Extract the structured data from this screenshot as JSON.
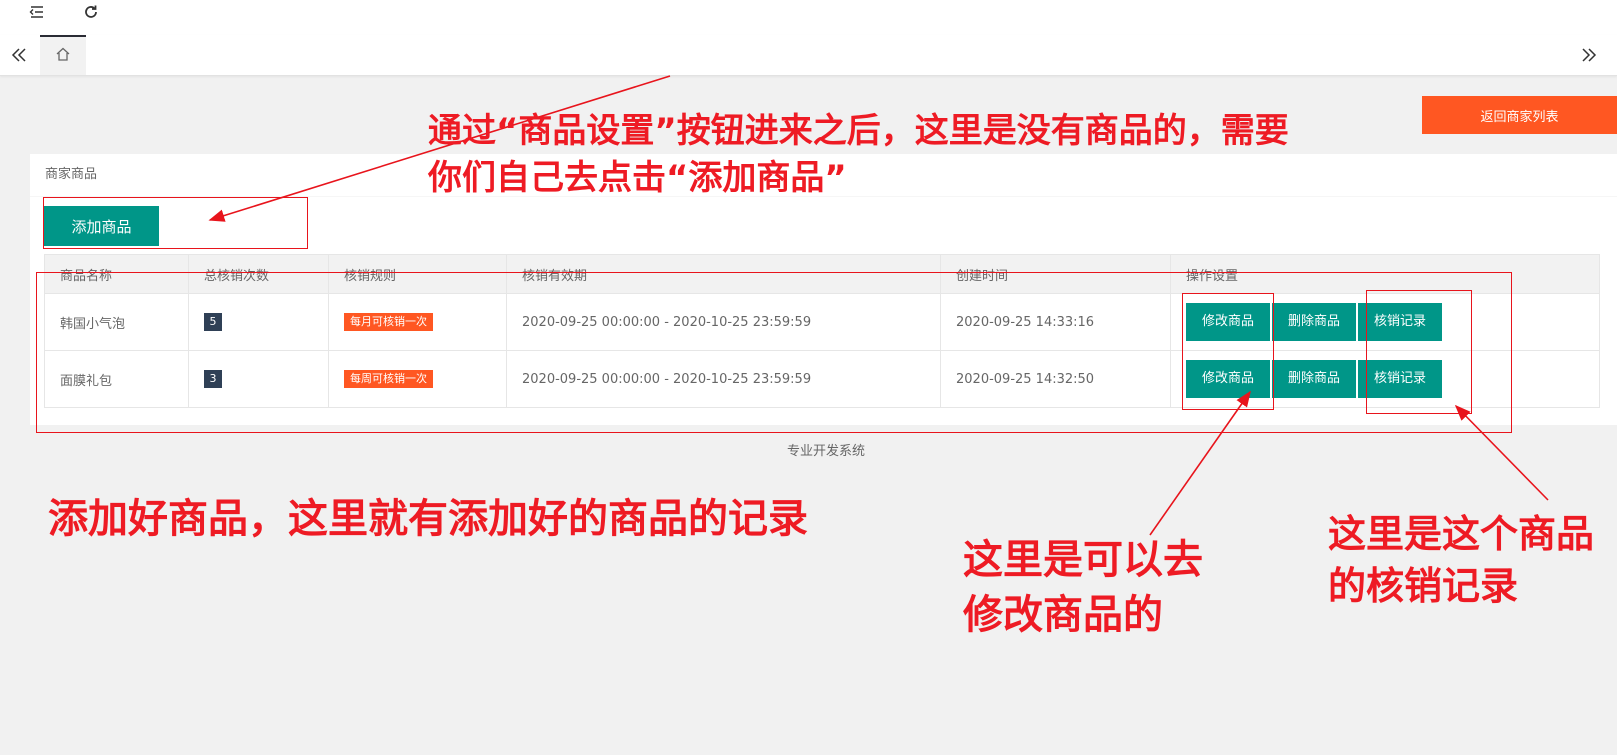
{
  "card": {
    "title": "商家商品"
  },
  "toolbar": {
    "return_label": "返回商家列表",
    "add_label": "添加商品"
  },
  "table": {
    "headers": [
      "商品名称",
      "总核销次数",
      "核销规则",
      "核销有效期",
      "创建时间",
      "操作设置"
    ],
    "rows": [
      {
        "name": "韩国小气泡",
        "count": "5",
        "rule": "每月可核销一次",
        "period": "2020-09-25 00:00:00 - 2020-10-25 23:59:59",
        "created": "2020-09-25 14:33:16",
        "actions": [
          "修改商品",
          "删除商品",
          "核销记录"
        ]
      },
      {
        "name": "面膜礼包",
        "count": "3",
        "rule": "每周可核销一次",
        "period": "2020-09-25 00:00:00 - 2020-10-25 23:59:59",
        "created": "2020-09-25 14:32:50",
        "actions": [
          "修改商品",
          "删除商品",
          "核销记录"
        ]
      }
    ]
  },
  "footer": "专业开发系统",
  "annotations": {
    "top_line1": "通过“商品设置”按钮进来之后，这里是没有商品的，需要",
    "top_line2": "你们自己去点击“添加商品”",
    "middle": "添加好商品，这里就有添加好的商品的记录",
    "edit_line1": "这里是可以去",
    "edit_line2": "修改商品的",
    "record_line1": "这里是这个商品",
    "record_line2": "的核销记录"
  },
  "colors": {
    "primary": "#009688",
    "warn": "#ff5722",
    "badge_dark": "#2f4056",
    "annotation": "#ee1b24"
  },
  "icons": [
    "shrink-menu-icon",
    "refresh-icon",
    "scroll-left-icon",
    "home-icon",
    "scroll-right-icon"
  ]
}
